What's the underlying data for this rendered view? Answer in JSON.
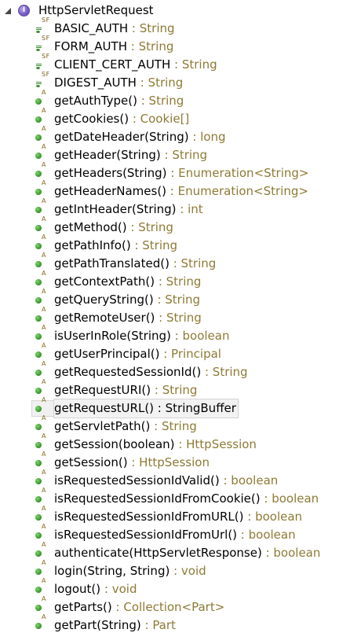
{
  "root": {
    "label": "HttpServletRequest",
    "icon": "interface-icon",
    "icon_letter": "I",
    "expanded": true
  },
  "fields": [
    {
      "name": "BASIC_AUTH",
      "sep": " : ",
      "type": "String",
      "modifier": "SF"
    },
    {
      "name": "FORM_AUTH",
      "sep": " : ",
      "type": "String",
      "modifier": "SF"
    },
    {
      "name": "CLIENT_CERT_AUTH",
      "sep": " : ",
      "type": "String",
      "modifier": "SF"
    },
    {
      "name": "DIGEST_AUTH",
      "sep": " : ",
      "type": "String",
      "modifier": "SF"
    }
  ],
  "methods": [
    {
      "name": "getAuthType()",
      "sep": " : ",
      "type": "String",
      "modifier": "A"
    },
    {
      "name": "getCookies()",
      "sep": " : ",
      "type": "Cookie[]",
      "modifier": "A"
    },
    {
      "name": "getDateHeader(String)",
      "sep": " : ",
      "type": "long",
      "modifier": "A"
    },
    {
      "name": "getHeader(String)",
      "sep": " : ",
      "type": "String",
      "modifier": "A"
    },
    {
      "name": "getHeaders(String)",
      "sep": " : ",
      "type": "Enumeration<String>",
      "modifier": "A"
    },
    {
      "name": "getHeaderNames()",
      "sep": " : ",
      "type": "Enumeration<String>",
      "modifier": "A"
    },
    {
      "name": "getIntHeader(String)",
      "sep": " : ",
      "type": "int",
      "modifier": "A"
    },
    {
      "name": "getMethod()",
      "sep": " : ",
      "type": "String",
      "modifier": "A"
    },
    {
      "name": "getPathInfo()",
      "sep": " : ",
      "type": "String",
      "modifier": "A"
    },
    {
      "name": "getPathTranslated()",
      "sep": " : ",
      "type": "String",
      "modifier": "A"
    },
    {
      "name": "getContextPath()",
      "sep": " : ",
      "type": "String",
      "modifier": "A"
    },
    {
      "name": "getQueryString()",
      "sep": " : ",
      "type": "String",
      "modifier": "A"
    },
    {
      "name": "getRemoteUser()",
      "sep": " : ",
      "type": "String",
      "modifier": "A"
    },
    {
      "name": "isUserInRole(String)",
      "sep": " : ",
      "type": "boolean",
      "modifier": "A"
    },
    {
      "name": "getUserPrincipal()",
      "sep": " : ",
      "type": "Principal",
      "modifier": "A"
    },
    {
      "name": "getRequestedSessionId()",
      "sep": " : ",
      "type": "String",
      "modifier": "A"
    },
    {
      "name": "getRequestURI()",
      "sep": " : ",
      "type": "String",
      "modifier": "A"
    },
    {
      "name": "getRequestURL()",
      "sep": " : ",
      "type": "StringBuffer",
      "modifier": "A",
      "selected": true
    },
    {
      "name": "getServletPath()",
      "sep": " : ",
      "type": "String",
      "modifier": "A"
    },
    {
      "name": "getSession(boolean)",
      "sep": " : ",
      "type": "HttpSession",
      "modifier": "A"
    },
    {
      "name": "getSession()",
      "sep": " : ",
      "type": "HttpSession",
      "modifier": "A"
    },
    {
      "name": "isRequestedSessionIdValid()",
      "sep": " : ",
      "type": "boolean",
      "modifier": "A"
    },
    {
      "name": "isRequestedSessionIdFromCookie()",
      "sep": " : ",
      "type": "boolean",
      "modifier": "A"
    },
    {
      "name": "isRequestedSessionIdFromURL()",
      "sep": " : ",
      "type": "boolean",
      "modifier": "A"
    },
    {
      "name": "isRequestedSessionIdFromUrl()",
      "sep": " : ",
      "type": "boolean",
      "modifier": "A"
    },
    {
      "name": "authenticate(HttpServletResponse)",
      "sep": " : ",
      "type": "boolean",
      "modifier": "A"
    },
    {
      "name": "login(String, String)",
      "sep": " : ",
      "type": "void",
      "modifier": "A"
    },
    {
      "name": "logout()",
      "sep": " : ",
      "type": "void",
      "modifier": "A"
    },
    {
      "name": "getParts()",
      "sep": " : ",
      "type": "Collection<Part>",
      "modifier": "A"
    },
    {
      "name": "getPart(String)",
      "sep": " : ",
      "type": "Part",
      "modifier": "A"
    }
  ],
  "colors": {
    "type_text": "#8e7a35",
    "method_dot": "#3c9a2e",
    "interface_icon": "#7a5fc8",
    "selection_bg": "#f0f0f0"
  }
}
